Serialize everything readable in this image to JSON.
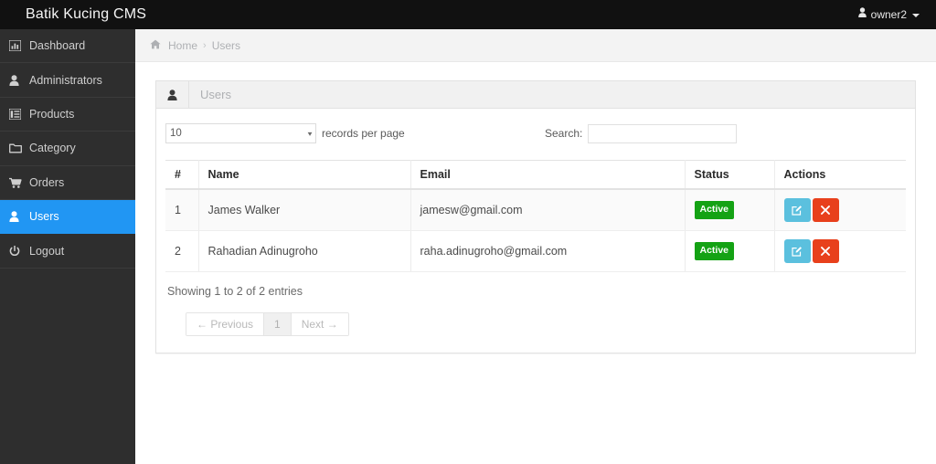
{
  "navbar": {
    "brand": "Batik Kucing CMS",
    "user_icon": "user-icon",
    "username": "owner2"
  },
  "sidebar": {
    "items": [
      {
        "label": "Dashboard",
        "icon": "chart-bar-icon",
        "active": false
      },
      {
        "label": "Administrators",
        "icon": "user-icon",
        "active": false
      },
      {
        "label": "Products",
        "icon": "list-icon",
        "active": false
      },
      {
        "label": "Category",
        "icon": "folder-icon",
        "active": false
      },
      {
        "label": "Orders",
        "icon": "cart-icon",
        "active": false
      },
      {
        "label": "Users",
        "icon": "user-icon",
        "active": true
      },
      {
        "label": "Logout",
        "icon": "power-icon",
        "active": false
      }
    ],
    "active_color": "#2196f3",
    "background": "#2e2e2e"
  },
  "breadcrumb": {
    "home_icon": "home-icon",
    "home": "Home",
    "separator": "›",
    "current": "Users"
  },
  "panel": {
    "icon": "user-icon",
    "title": "Users"
  },
  "controls": {
    "page_length_value": "10",
    "page_length_caret": "▾",
    "records_label": "records per page",
    "search_label": "Search:",
    "search_value": "",
    "search_placeholder": ""
  },
  "table": {
    "columns": [
      "#",
      "Name",
      "Email",
      "Status",
      "Actions"
    ],
    "rows": [
      {
        "num": "1",
        "name": "James Walker",
        "email": "jamesw@gmail.com",
        "status": "Active",
        "edit_icon": "edit-square-icon",
        "delete_icon": "close-x-icon"
      },
      {
        "num": "2",
        "name": "Rahadian Adinugroho",
        "email": "raha.adinugroho@gmail.com",
        "status": "Active",
        "edit_icon": "edit-square-icon",
        "delete_icon": "close-x-icon"
      }
    ],
    "status_color": "#14a214",
    "edit_color": "#5bc0de",
    "delete_color": "#e8401c"
  },
  "footer": {
    "info": "Showing 1 to 2 of 2 entries",
    "pagination": {
      "previous": "← Previous",
      "pages": [
        "1"
      ],
      "next": "Next →"
    }
  }
}
